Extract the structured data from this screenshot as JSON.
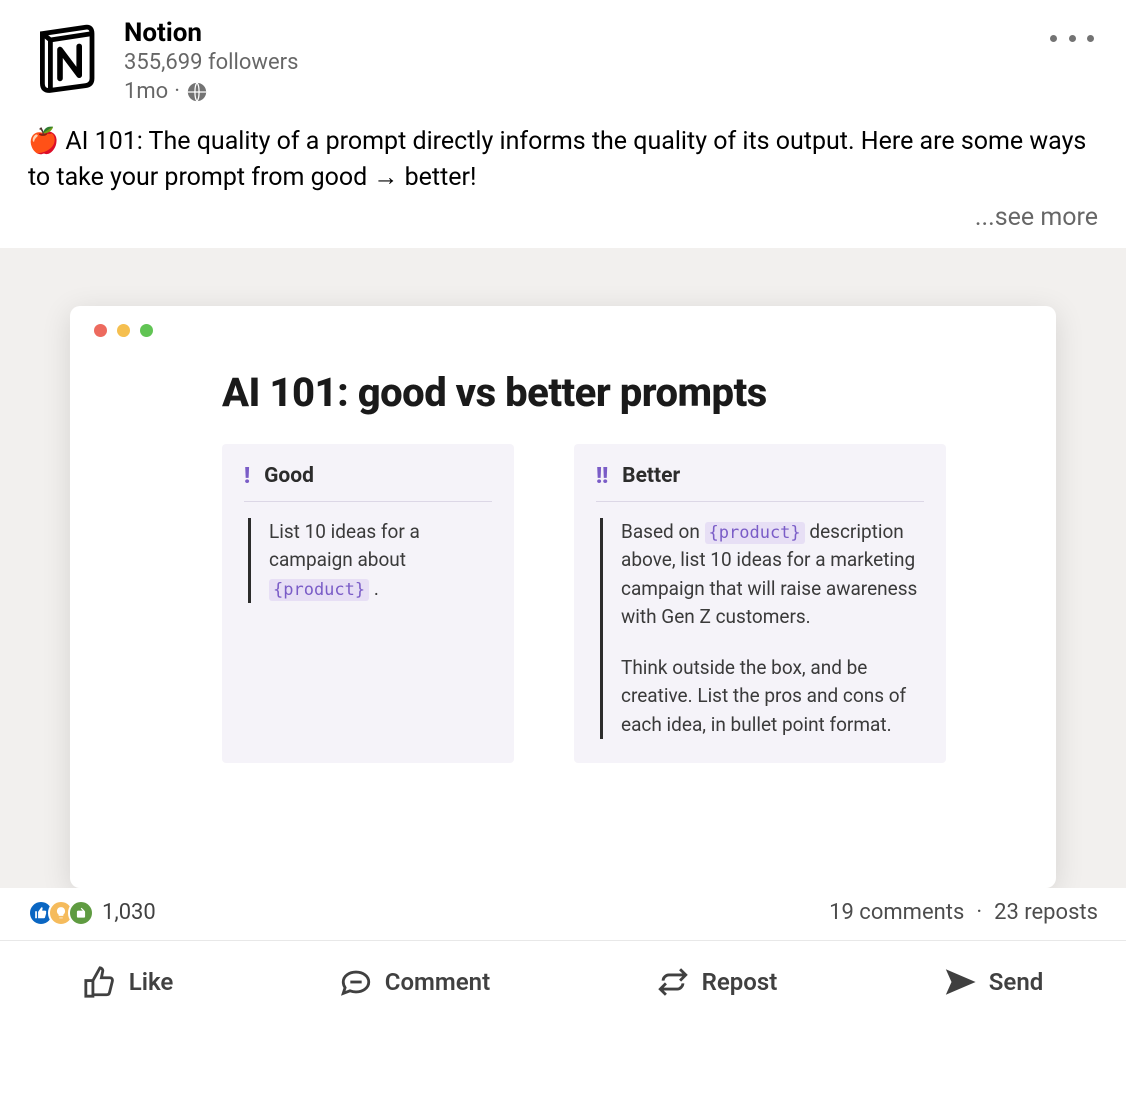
{
  "header": {
    "actor_name": "Notion",
    "followers": "355,699 followers",
    "time": "1mo",
    "dot": "·"
  },
  "body": {
    "text": "🍎 AI 101: The quality of a prompt directly informs the quality of its output. Here are some ways to take your prompt from good → better!",
    "see_more": "...see more"
  },
  "doc": {
    "title": "AI 101: good vs better prompts",
    "good": {
      "marker": "!",
      "label": "Good",
      "p1a": "List 10 ideas for a campaign about ",
      "token": "{product}",
      "p1b": " ."
    },
    "better": {
      "marker": "!!",
      "label": "Better",
      "p1a": "Based on ",
      "token": "{product}",
      "p1b": " description above, list 10 ideas for a marketing campaign that will raise awareness with Gen Z customers.",
      "p2": "Think outside the box, and be creative. List the pros and cons of each idea, in bullet point format."
    }
  },
  "counts": {
    "reactions": "1,030",
    "comments": "19 comments",
    "sep": "·",
    "reposts": "23 reposts"
  },
  "actions": {
    "like": "Like",
    "comment": "Comment",
    "repost": "Repost",
    "send": "Send"
  }
}
